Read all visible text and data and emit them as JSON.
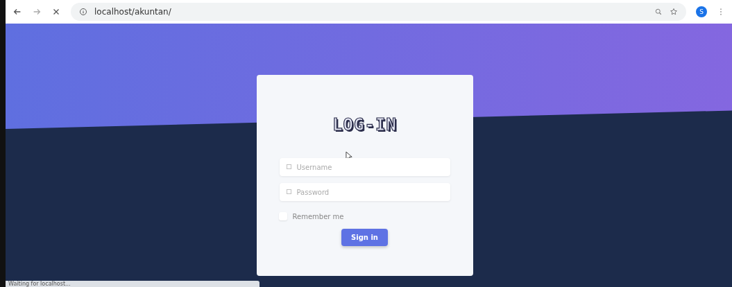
{
  "browser": {
    "url": "localhost/akuntan/",
    "avatar": "S"
  },
  "login": {
    "title": "LOG-IN",
    "fields": [
      {
        "placeholder": "Username"
      },
      {
        "placeholder": "Password"
      }
    ],
    "remember": {
      "label": "Remember me",
      "checked": false
    },
    "button": "Sign in"
  },
  "status_bar": "Waiting for localhost..."
}
